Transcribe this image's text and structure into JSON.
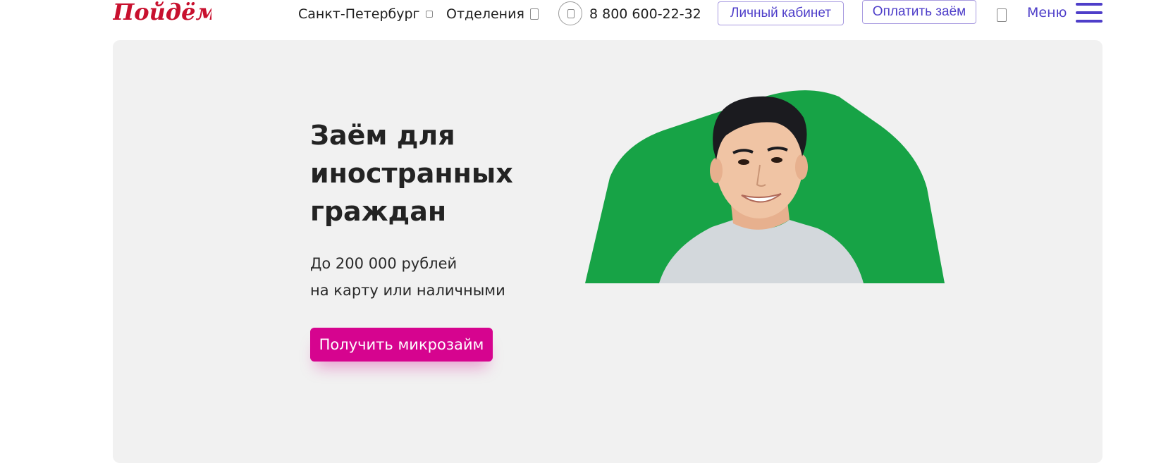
{
  "header": {
    "logo_text": "Пойдём!",
    "city": "Санкт-Петербург",
    "offices": "Отделения",
    "phone": "8 800 600-22-32",
    "cabinet_button": "Личный кабинет",
    "pay_button": "Оплатить заём",
    "menu_label": "Меню"
  },
  "hero": {
    "title": "Заём для иностранных граждан",
    "sub_line1": "До 200 000 рублей",
    "sub_line2": "на карту или наличными",
    "cta": "Получить микрозайм"
  },
  "colors": {
    "brand_purple": "#4e3ec9",
    "cta_magenta": "#d6048f",
    "logo_red": "#c8102e",
    "hero_bg": "#f1f1f1",
    "accent_green": "#17a346"
  },
  "icons": {
    "city_chevron": "chevron-down-icon",
    "offices_icon": "map-pin-icon",
    "phone_icon": "phone-icon",
    "mobile_icon": "mobile-app-icon",
    "burger_icon": "hamburger-menu-icon"
  }
}
